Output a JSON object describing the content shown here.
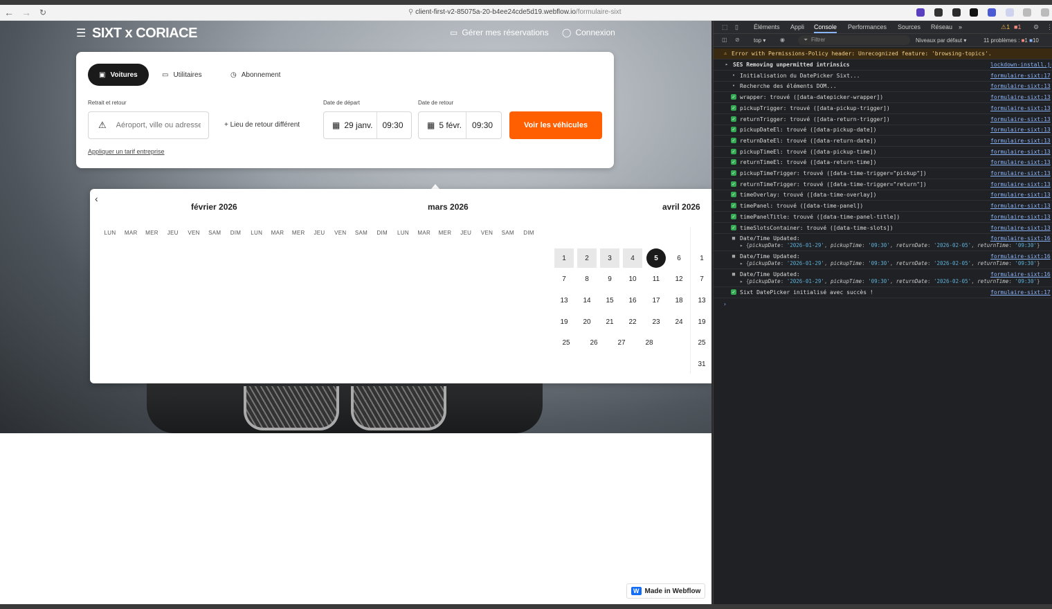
{
  "browser": {
    "url_host": "client-first-v2-85075a-20-b4ee24cde5d19.webflow.io",
    "url_path": "/formulaire-sixt"
  },
  "site": {
    "logo": "SIXT x CORIACE",
    "manage_bookings": "Gérer mes réservations",
    "login": "Connexion"
  },
  "booking": {
    "tabs": [
      "Voitures",
      "Utilitaires",
      "Abonnement"
    ],
    "pickup_label": "Retrait et retour",
    "location_placeholder": "Aéroport, ville ou adresse",
    "different_return": "Lieu de retour différent",
    "departure_label": "Date de départ",
    "return_label": "Date de retour",
    "departure_date": "29 janv.",
    "departure_time": "09:30",
    "return_date": "5 févr.",
    "return_time": "09:30",
    "search_button": "Voir les véhicules",
    "corporate_link": "Appliquer un tarif entreprise"
  },
  "calendar": {
    "months": [
      "février 2026",
      "mars 2026",
      "avril 2026"
    ],
    "weekdays": [
      "LUN",
      "MAR",
      "MER",
      "JEU",
      "VEN",
      "SAM",
      "DIM",
      "LUN",
      "MAR",
      "MER",
      "JEU",
      "VEN",
      "SAM",
      "DIM",
      "LUN",
      "MAR",
      "MER",
      "JEU",
      "VEN",
      "SAM",
      "DIM"
    ],
    "selected_day": "5",
    "range_days": [
      "1",
      "2",
      "3",
      "4"
    ]
  },
  "webflow_badge": "Made in Webflow",
  "devtools": {
    "tabs": [
      "Éléments",
      "Appli",
      "Console",
      "Performances",
      "Sources",
      "Réseau"
    ],
    "active_tab": "Console",
    "context": "top",
    "filter_placeholder": "Filtrer",
    "levels": "Niveaux par défaut",
    "problems": "11 problèmes :",
    "warning_count": "1",
    "error_count": "1",
    "info_count": "10",
    "logs": [
      {
        "type": "warn",
        "msg": "Error with Permissions-Policy header: Unrecognized feature: 'browsing-topics'.",
        "src": ""
      },
      {
        "type": "group",
        "msg": "SES Removing unpermitted intrinsics",
        "src": "lockdown-install.js"
      },
      {
        "type": "log",
        "msg": "Initialisation du DatePicker Sixt...",
        "src": "formulaire-sixt:17"
      },
      {
        "type": "log",
        "msg": "Recherche des éléments DOM...",
        "src": "formulaire-sixt:13"
      },
      {
        "type": "ok",
        "msg": "wrapper: trouvé ([data-datepicker-wrapper])",
        "src": "formulaire-sixt:13"
      },
      {
        "type": "ok",
        "msg": "pickupTrigger: trouvé ([data-pickup-trigger])",
        "src": "formulaire-sixt:13"
      },
      {
        "type": "ok",
        "msg": "returnTrigger: trouvé ([data-return-trigger])",
        "src": "formulaire-sixt:13"
      },
      {
        "type": "ok",
        "msg": "pickupDateEl: trouvé ([data-pickup-date])",
        "src": "formulaire-sixt:13"
      },
      {
        "type": "ok",
        "msg": "returnDateEl: trouvé ([data-return-date])",
        "src": "formulaire-sixt:13"
      },
      {
        "type": "ok",
        "msg": "pickupTimeEl: trouvé ([data-pickup-time])",
        "src": "formulaire-sixt:13"
      },
      {
        "type": "ok",
        "msg": "returnTimeEl: trouvé ([data-return-time])",
        "src": "formulaire-sixt:13"
      },
      {
        "type": "ok",
        "msg": "pickupTimeTrigger: trouvé ([data-time-trigger=\"pickup\"])",
        "src": "formulaire-sixt:13"
      },
      {
        "type": "ok",
        "msg": "returnTimeTrigger: trouvé ([data-time-trigger=\"return\"])",
        "src": "formulaire-sixt:13"
      },
      {
        "type": "ok",
        "msg": "timeOverlay: trouvé ([data-time-overlay])",
        "src": "formulaire-sixt:13"
      },
      {
        "type": "ok",
        "msg": "timePanel: trouvé ([data-time-panel])",
        "src": "formulaire-sixt:13"
      },
      {
        "type": "ok",
        "msg": "timePanelTitle: trouvé ([data-time-panel-title])",
        "src": "formulaire-sixt:13"
      },
      {
        "type": "ok",
        "msg": "timeSlotsContainer: trouvé ([data-time-slots])",
        "src": "formulaire-sixt:13"
      }
    ],
    "updates": [
      {
        "title": "Date/Time Updated:",
        "src": "formulaire-sixt:16"
      },
      {
        "title": "Date/Time Updated:",
        "src": "formulaire-sixt:16"
      },
      {
        "title": "Date/Time Updated:",
        "src": "formulaire-sixt:16"
      }
    ],
    "update_obj": {
      "pickupDate": "'2026-01-29'",
      "pickupTime": "'09:30'",
      "returnDate": "'2026-02-05'",
      "returnTime": "'09:30'"
    },
    "success": {
      "msg": "Sixt DatePicker initialisé avec succès !",
      "src": "formulaire-sixt:17"
    }
  }
}
